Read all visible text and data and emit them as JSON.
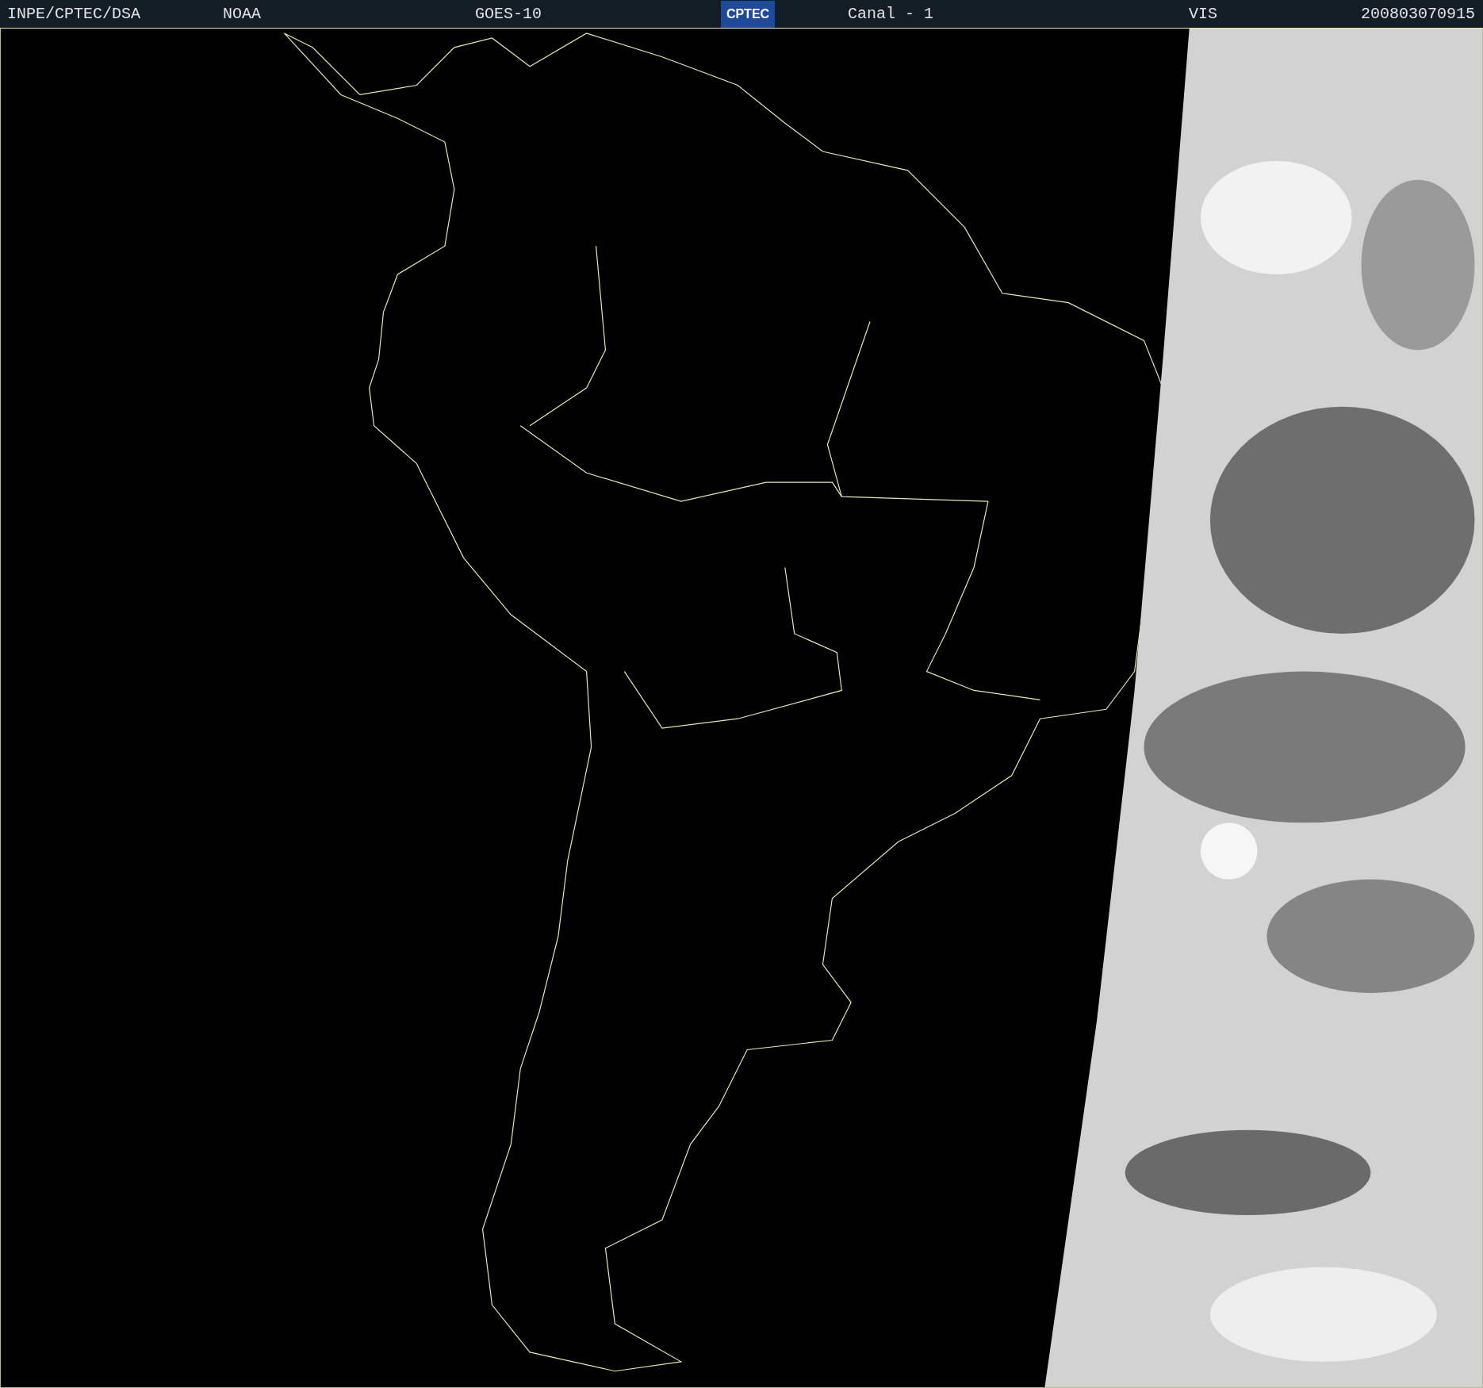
{
  "header": {
    "items": [
      {
        "kind": "text",
        "text": "INPE/CPTEC/DSA"
      },
      {
        "kind": "text",
        "text": "NOAA"
      },
      {
        "kind": "text",
        "text": "GOES-10"
      },
      {
        "kind": "logo",
        "text": "CPTEC"
      },
      {
        "kind": "text",
        "text": "Canal - 1"
      },
      {
        "kind": "text",
        "text": "VIS"
      },
      {
        "kind": "text",
        "text": "200803070915"
      }
    ]
  }
}
